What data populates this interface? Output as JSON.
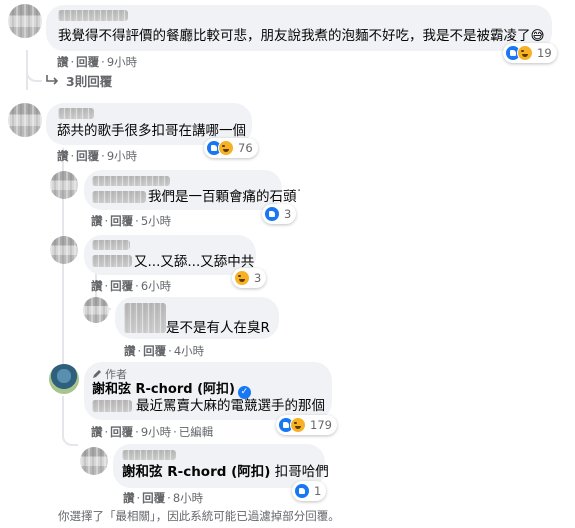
{
  "comments": [
    {
      "text": "我覺得不得評價的餐廳比較可悲，朋友說我煮的泡麵不好吃，我是不是被霸凌了😅",
      "actions": [
        "讚",
        "回覆",
        "9小時"
      ],
      "reaction_count": "19",
      "replies_toggle": "3則回覆"
    },
    {
      "text": "舔共的歌手很多扣哥在講哪一個",
      "actions": [
        "讚",
        "回覆",
        "9小時"
      ],
      "reaction_count": "76"
    }
  ],
  "replies": [
    {
      "text": "我們是一百顆會痛的石頭",
      "actions": [
        "讚",
        "回覆",
        "5小時"
      ],
      "reaction_count": "3"
    },
    {
      "text": "又...又舔...又舔中共",
      "actions": [
        "讚",
        "回覆",
        "6小時"
      ],
      "reaction_count": "3"
    },
    {
      "text": "是不是有人在臭R",
      "actions": [
        "讚",
        "回覆",
        "4小時"
      ]
    },
    {
      "author_badge": "作者",
      "author": "謝和弦 R-chord (阿扣)",
      "text": "最近罵賣大麻的電競選手的那個",
      "actions": [
        "讚",
        "回覆",
        "9小時",
        "已編輯"
      ],
      "reaction_count": "179"
    },
    {
      "mention": "謝和弦 R-chord (阿扣)",
      "text": "扣哥哈們",
      "actions": [
        "讚",
        "回覆",
        "8小時"
      ],
      "reaction_count": "1"
    }
  ],
  "footer_note": "你選擇了「最相關」，因此系統可能已過濾掉部分回覆。",
  "icons": {
    "like": "like-reaction-icon",
    "haha": "haha-reaction-icon",
    "more": "more-options-icon",
    "reply_arrow": "reply-arrow-icon",
    "verified": "verified-badge-icon",
    "pencil": "pencil-icon"
  },
  "colors": {
    "bubble": "#f0f2f5",
    "meta_text": "#65676b",
    "like_blue": "#1877f2",
    "haha_yellow": "#f7b125",
    "thread_line": "#e4e6eb"
  }
}
